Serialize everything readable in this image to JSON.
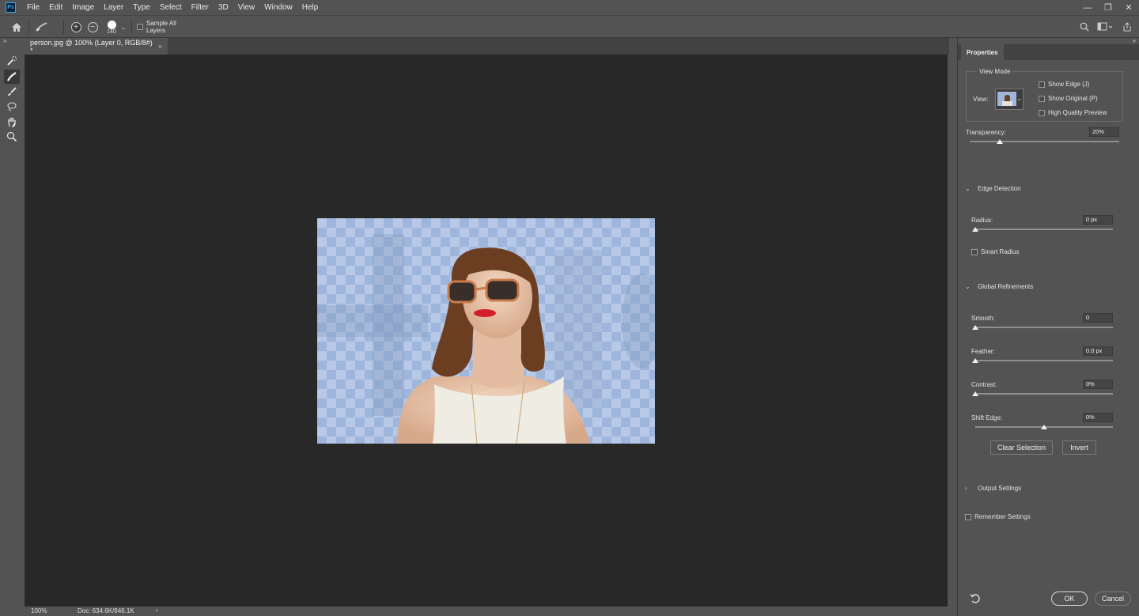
{
  "menubar": {
    "logo_text": "Ps",
    "items": [
      "File",
      "Edit",
      "Image",
      "Layer",
      "Type",
      "Select",
      "Filter",
      "3D",
      "View",
      "Window",
      "Help"
    ],
    "window_controls": [
      "minimize-icon",
      "restore-icon",
      "close-icon"
    ]
  },
  "options": {
    "brush_size": "140",
    "sample_all_layers_label": "Sample All Layers",
    "sample_all_layers_checked": false
  },
  "toolbar": {
    "tools": [
      {
        "name": "quick-selection-tool-icon",
        "active": false
      },
      {
        "name": "refine-edge-brush-icon",
        "active": true
      },
      {
        "name": "brush-tool-icon",
        "active": false
      },
      {
        "name": "lasso-tool-icon",
        "active": false
      },
      {
        "name": "hand-tool-icon",
        "active": false
      },
      {
        "name": "zoom-tool-icon",
        "active": false
      }
    ]
  },
  "document": {
    "tab_title": "person.jpg @ 100% (Layer 0, RGB/8#) *",
    "tab_close": "×"
  },
  "status": {
    "zoom": "100%",
    "doc_info": "Doc: 634.6K/846.1K",
    "arrow": "›"
  },
  "panel": {
    "tab": "Properties",
    "view_mode": {
      "title": "View Mode",
      "view_label": "View:",
      "show_edge": "Show Edge (J)",
      "show_original": "Show Original (P)",
      "high_quality": "High Quality Preview"
    },
    "transparency": {
      "label": "Transparency:",
      "value": "20%",
      "level": 0.2
    },
    "edge_detection": {
      "title": "Edge Detection",
      "radius_label": "Radius:",
      "radius_value": "0 px",
      "radius_level": 0.0,
      "smart_radius": "Smart Radius"
    },
    "global_refinements": {
      "title": "Global Refinements",
      "smooth_label": "Smooth:",
      "smooth_value": "0",
      "smooth_level": 0.0,
      "feather_label": "Feather:",
      "feather_value": "0.0 px",
      "feather_level": 0.0,
      "contrast_label": "Contrast:",
      "contrast_value": "0%",
      "contrast_level": 0.0,
      "shift_edge_label": "Shift Edge:",
      "shift_edge_value": "0%",
      "shift_edge_level": 0.5
    },
    "clear_selection": "Clear Selection",
    "invert": "Invert",
    "output_settings": "Output Settings",
    "remember_settings": "Remember Settings",
    "ok": "OK",
    "cancel": "Cancel"
  }
}
